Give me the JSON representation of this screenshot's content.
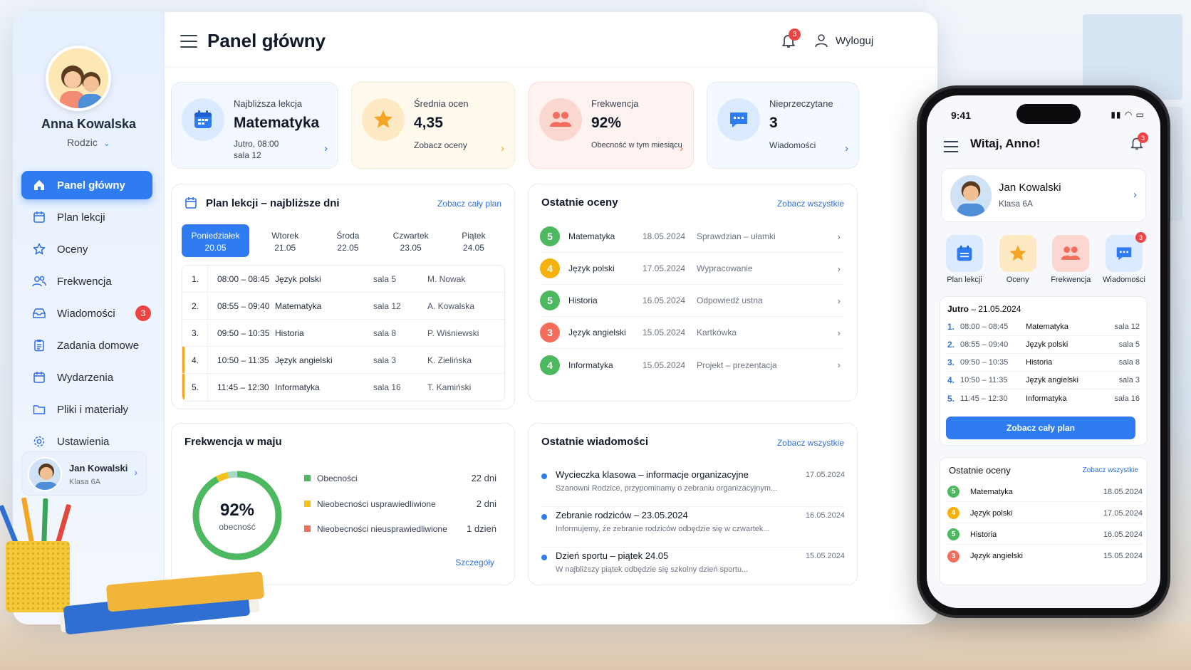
{
  "colors": {
    "accent": "#2f7cf0",
    "danger": "#ef4444",
    "green": "#4cb860",
    "orange": "#f5a524"
  },
  "sidebar": {
    "user_name": "Anna Kowalska",
    "user_role": "Rodzic",
    "items": [
      {
        "label": "Panel główny",
        "icon": "home-icon",
        "active": true
      },
      {
        "label": "Plan lekcji",
        "icon": "calendar-icon"
      },
      {
        "label": "Oceny",
        "icon": "star-icon"
      },
      {
        "label": "Frekwencja",
        "icon": "users-icon"
      },
      {
        "label": "Wiadomości",
        "icon": "inbox-icon",
        "badge": "3"
      },
      {
        "label": "Zadania domowe",
        "icon": "clipboard-icon"
      },
      {
        "label": "Wydarzenia",
        "icon": "calendar-event-icon"
      },
      {
        "label": "Pliki i materiały",
        "icon": "folder-icon"
      },
      {
        "label": "Ustawienia",
        "icon": "gear-icon"
      }
    ],
    "child": {
      "name": "Jan Kowalski",
      "class": "Klasa 6A"
    }
  },
  "header": {
    "title": "Panel główny",
    "notifications": "3",
    "logout": "Wyloguj"
  },
  "stats": [
    {
      "label": "Najbliższa lekcja",
      "value": "Matematyka",
      "sub1": "Jutro, 08:00",
      "sub2": "sala 12"
    },
    {
      "label": "Średnia ocen",
      "value": "4,35",
      "sub1": "Zobacz oceny"
    },
    {
      "label": "Frekwencja",
      "value": "92%",
      "sub1": "Obecność w tym miesiącu"
    },
    {
      "label": "Nieprzeczytane",
      "value": "3",
      "sub1": "Wiadomości"
    }
  ],
  "schedule": {
    "title": "Plan lekcji – najbliższe dni",
    "link": "Zobacz cały plan",
    "days": [
      {
        "name": "Poniedziałek",
        "date": "20.05"
      },
      {
        "name": "Wtorek",
        "date": "21.05"
      },
      {
        "name": "Środa",
        "date": "22.05"
      },
      {
        "name": "Czwartek",
        "date": "23.05"
      },
      {
        "name": "Piątek",
        "date": "24.05"
      }
    ],
    "rows": [
      {
        "num": "1.",
        "time": "08:00 – 08:45",
        "subject": "Język polski",
        "room": "sala 5",
        "teacher": "M. Nowak"
      },
      {
        "num": "2.",
        "time": "08:55 – 09:40",
        "subject": "Matematyka",
        "room": "sala 12",
        "teacher": "A. Kowalska"
      },
      {
        "num": "3.",
        "time": "09:50 – 10:35",
        "subject": "Historia",
        "room": "sala 8",
        "teacher": "P. Wiśniewski"
      },
      {
        "num": "4.",
        "time": "10:50 – 11:35",
        "subject": "Język angielski",
        "room": "sala 3",
        "teacher": "K. Zielińska"
      },
      {
        "num": "5.",
        "time": "11:45 – 12:30",
        "subject": "Informatyka",
        "room": "sala 16",
        "teacher": "T. Kamiński"
      }
    ]
  },
  "grades": {
    "title": "Ostatnie oceny",
    "link": "Zobacz wszystkie",
    "rows": [
      {
        "grade": "5",
        "color": "#4cb860",
        "subject": "Matematyka",
        "date": "18.05.2024",
        "desc": "Sprawdzian – ułamki"
      },
      {
        "grade": "4",
        "color": "#f5b10d",
        "subject": "Język polski",
        "date": "17.05.2024",
        "desc": "Wypracowanie"
      },
      {
        "grade": "5",
        "color": "#4cb860",
        "subject": "Historia",
        "date": "16.05.2024",
        "desc": "Odpowiedź ustna"
      },
      {
        "grade": "3",
        "color": "#f26d5b",
        "subject": "Język angielski",
        "date": "15.05.2024",
        "desc": "Kartkówka"
      },
      {
        "grade": "4",
        "color": "#4cb860",
        "subject": "Informatyka",
        "date": "15.05.2024",
        "desc": "Projekt – prezentacja"
      }
    ]
  },
  "attendance": {
    "title": "Frekwencja w maju",
    "percent": "92%",
    "percent_label": "obecność",
    "fraction": 0.92,
    "link": "Szczegóły",
    "legend": [
      {
        "label": "Obecności",
        "value": "22 dni",
        "color": "#4cb860"
      },
      {
        "label": "Nieobecności usprawiedliwione",
        "value": "2 dni",
        "color": "#f5c21b"
      },
      {
        "label": "Nieobecności nieusprawiedliwione",
        "value": "1 dzień",
        "color": "#f26d5b"
      }
    ]
  },
  "messages": {
    "title": "Ostatnie wiadomości",
    "link": "Zobacz wszystkie",
    "rows": [
      {
        "title": "Wycieczka klasowa – informacje organizacyjne",
        "body": "Szanowni Rodzice, przypominamy o zebraniu organizacyjnym...",
        "date": "17.05.2024"
      },
      {
        "title": "Zebranie rodziców – 23.05.2024",
        "body": "Informujemy, że zebranie rodziców odbędzie się w czwartek...",
        "date": "16.05.2024"
      },
      {
        "title": "Dzień sportu – piątek 24.05",
        "body": "W najbliższy piątek odbędzie się szkolny dzień sportu...",
        "date": "15.05.2024"
      }
    ]
  },
  "phone": {
    "time": "9:41",
    "greeting": "Witaj, Anno!",
    "notifications": "3",
    "child": {
      "name": "Jan Kowalski",
      "class": "Klasa 6A"
    },
    "quick": [
      {
        "label": "Plan lekcji",
        "icon": "calendar-icon"
      },
      {
        "label": "Oceny",
        "icon": "star-icon"
      },
      {
        "label": "Frekwencja",
        "icon": "users-icon"
      },
      {
        "label": "Wiadomości",
        "icon": "chat-icon",
        "badge": "3"
      }
    ],
    "schedule_day": "Jutro",
    "schedule_date": "21.05.2024",
    "rows": [
      {
        "num": "1.",
        "time": "08:00 – 08:45",
        "subject": "Matematyka",
        "room": "sala 12"
      },
      {
        "num": "2.",
        "time": "08:55 – 09:40",
        "subject": "Język polski",
        "room": "sala 5"
      },
      {
        "num": "3.",
        "time": "09:50 – 10:35",
        "subject": "Historia",
        "room": "sala 8"
      },
      {
        "num": "4.",
        "time": "10:50 – 11:35",
        "subject": "Język angielski",
        "room": "sala 3"
      },
      {
        "num": "5.",
        "time": "11:45 – 12:30",
        "subject": "Informatyka",
        "room": "sala 16"
      }
    ],
    "button": "Zobacz cały plan",
    "grades_title": "Ostatnie oceny",
    "grades_link": "Zobacz wszystkie",
    "grades": [
      {
        "grade": "5",
        "color": "#4cb860",
        "subject": "Matematyka",
        "date": "18.05.2024"
      },
      {
        "grade": "4",
        "color": "#f5b10d",
        "subject": "Język polski",
        "date": "17.05.2024"
      },
      {
        "grade": "5",
        "color": "#4cb860",
        "subject": "Historia",
        "date": "16.05.2024"
      },
      {
        "grade": "3",
        "color": "#f26d5b",
        "subject": "Język angielski",
        "date": "15.05.2024"
      }
    ]
  }
}
